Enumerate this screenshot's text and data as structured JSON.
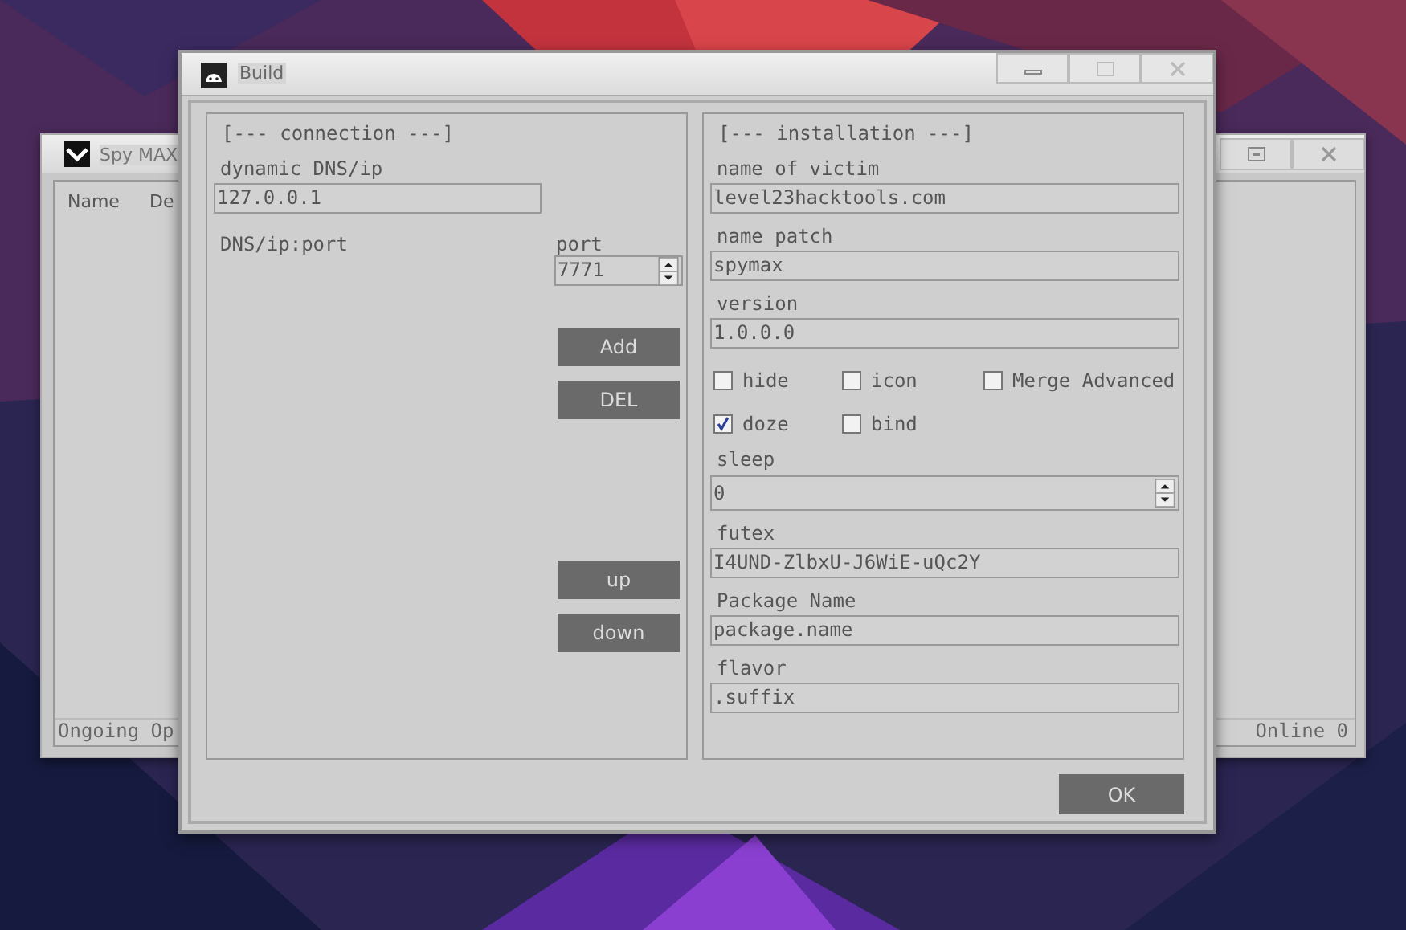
{
  "back_window": {
    "title": "Spy MAX",
    "columns": [
      "Name",
      "De"
    ],
    "status_left": "Ongoing Op",
    "status_right": "Online 0"
  },
  "dialog": {
    "title": "Build",
    "connection": {
      "heading": "[--- connection ---]",
      "dns_label": "dynamic DNS/ip",
      "dns_value": "127.0.0.1",
      "list_label": "DNS/ip:port",
      "port_label": "port",
      "port_value": "7771",
      "buttons": [
        "Add",
        "DEL"
      ],
      "order_buttons": [
        "up",
        "down"
      ]
    },
    "installation": {
      "heading": "[--- installation ---]",
      "items": [
        {
          "kind": "text",
          "label": "name of victim",
          "value": "level23hacktools.com"
        },
        {
          "kind": "text",
          "label": "name patch",
          "value": "spymax"
        },
        {
          "kind": "text",
          "label": "version",
          "value": "1.0.0.0"
        },
        {
          "kind": "checks",
          "options": [
            {
              "label": "hide",
              "checked": false
            },
            {
              "label": "icon",
              "checked": false
            },
            {
              "label": "Merge Advanced",
              "checked": false
            }
          ]
        },
        {
          "kind": "checks",
          "options": [
            {
              "label": "doze",
              "checked": true
            },
            {
              "label": "bind",
              "checked": false
            }
          ]
        },
        {
          "kind": "spin",
          "label": "sleep",
          "value": "0"
        },
        {
          "kind": "text",
          "label": "futex",
          "value": "I4UND-ZlbxU-J6WiE-uQc2Y"
        },
        {
          "kind": "text",
          "label": "Package Name",
          "value": "package.name"
        },
        {
          "kind": "text",
          "label": "flavor",
          "value": ".suffix"
        }
      ]
    },
    "ok_button": "OK"
  }
}
